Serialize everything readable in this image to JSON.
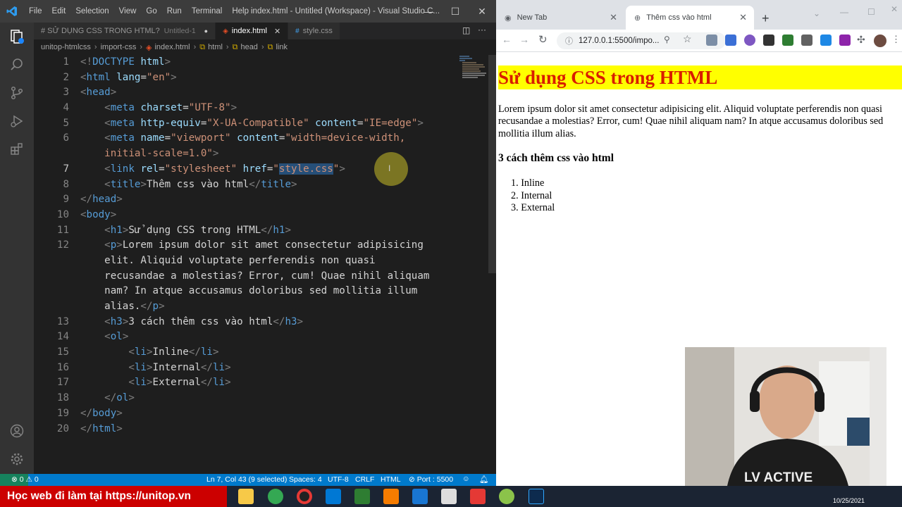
{
  "vscode": {
    "menu": [
      "File",
      "Edit",
      "Selection",
      "View",
      "Go",
      "Run",
      "Terminal",
      "Help"
    ],
    "window_title": "index.html - Untitled (Workspace) - Visual Studio C...",
    "tabs": [
      {
        "label": "# SỬ DỤNG CSS TRONG HTML?",
        "sub": "Untitled-1",
        "modified": true
      },
      {
        "label": "index.html",
        "active": true
      },
      {
        "label": "style.css"
      }
    ],
    "breadcrumb": [
      "unitop-htmlcss",
      "import-css",
      "index.html",
      "html",
      "head",
      "link"
    ],
    "line_numbers": [
      "1",
      "2",
      "3",
      "4",
      "5",
      "6",
      "",
      "7",
      "8",
      "9",
      "10",
      "11",
      "12",
      "",
      "",
      "",
      "",
      "13",
      "14",
      "15",
      "16",
      "17",
      "18",
      "19",
      "20"
    ],
    "status": {
      "errors": "0",
      "warnings": "0",
      "position": "Ln 7, Col 43 (9 selected)",
      "spaces": "Spaces: 4",
      "encoding": "UTF-8",
      "eol": "CRLF",
      "language": "HTML",
      "port": "Port : 5500"
    }
  },
  "chrome": {
    "tabs": [
      "New Tab",
      "Thêm css vào html"
    ],
    "url": "127.0.0.1:5500/impo...",
    "page": {
      "h1": "Sử dụng CSS trong HTML",
      "paragraph": "Lorem ipsum dolor sit amet consectetur adipisicing elit. Aliquid voluptate perferendis non quasi recusandae a molestias? Error, cum! Quae nihil aliquam nam? In atque accusamus doloribus sed mollitia illum alias.",
      "h3": "3 cách thêm css vào html",
      "list": [
        "1. Inline",
        "2. Internal",
        "3. External"
      ]
    }
  },
  "webcam": {
    "shirt_text": "LV ACTIVE"
  },
  "taskbar": {
    "promo": "Học web đi làm tại https://unitop.vn",
    "clock": "10/25/2021"
  },
  "colors": {
    "h1_bg": "#ffff00",
    "h1_text": "#d91d00",
    "status_bar": "#007acc",
    "promo": "#cc0000"
  }
}
